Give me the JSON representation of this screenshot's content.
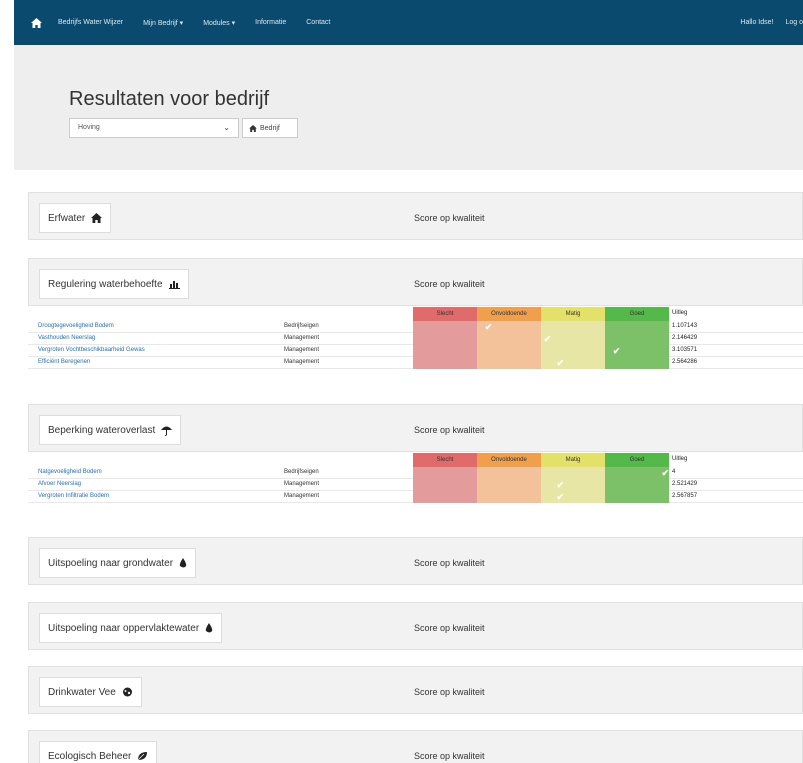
{
  "navbar": {
    "links": [
      "Bedrijfs Water Wijzer",
      "Mijn Bedrijf",
      "Modules",
      "Informatie",
      "Contact"
    ],
    "greeting": "Hallo Idse!",
    "logout": "Log o"
  },
  "header": {
    "title": "Resultaten voor bedrijf",
    "select_value": "Hoving",
    "bedrijf_button": "Bedrijf"
  },
  "panels": [
    {
      "title": "Erfwater",
      "icon": "home-icon",
      "score": "Score op kwaliteit"
    },
    {
      "title": "Regulering waterbehoefte",
      "icon": "bar-chart-icon",
      "score": "Score op kwaliteit"
    },
    {
      "title": "Beperking wateroverlast",
      "icon": "umbrella-icon",
      "score": "Score op kwaliteit"
    },
    {
      "title": "Uitspoeling naar grondwater",
      "icon": "drop-icon",
      "score": "Score op kwaliteit"
    },
    {
      "title": "Uitspoeling naar oppervlaktewater",
      "icon": "drop-icon",
      "score": "Score op kwaliteit"
    },
    {
      "title": "Drinkwater Vee",
      "icon": "cow-icon",
      "score": "Score op kwaliteit"
    },
    {
      "title": "Ecologisch Beheer",
      "icon": "leaf-icon",
      "score": "Score op kwaliteit"
    }
  ],
  "score_headers": [
    "Slecht",
    "Onvoldoende",
    "Matig",
    "Goed"
  ],
  "uitleg_header": "Uitleg",
  "colors": {
    "slecht": "#e06b6b",
    "onvoldoende": "#f0a04c",
    "matig": "#e3e16a",
    "goed": "#55b84a",
    "navbar": "#0a4a6e"
  },
  "table_regulering": [
    {
      "name": "Droogtegevoeligheid Bodem",
      "type": "Bedrijfseigen",
      "value": "1.107143",
      "position": 0.3
    },
    {
      "name": "Vasthouden Neerslag",
      "type": "Management",
      "value": "2.146429",
      "position": 0.53
    },
    {
      "name": "Vergroten Vochtbeschikbaarheid Gewas",
      "type": "Management",
      "value": "3.103571",
      "position": 0.8
    },
    {
      "name": "Efficiënt Beregenen",
      "type": "Management",
      "value": "2.564286",
      "position": 0.58
    }
  ],
  "table_beperking": [
    {
      "name": "Natgevoeligheid Bodem",
      "type": "Bedrijfseigen",
      "value": "4",
      "position": 0.99
    },
    {
      "name": "Afvoer Neerslag",
      "type": "Management",
      "value": "2.521429",
      "position": 0.58
    },
    {
      "name": "Vergroten Infiltratie Bodem",
      "type": "Management",
      "value": "2.567857",
      "position": 0.58
    }
  ]
}
